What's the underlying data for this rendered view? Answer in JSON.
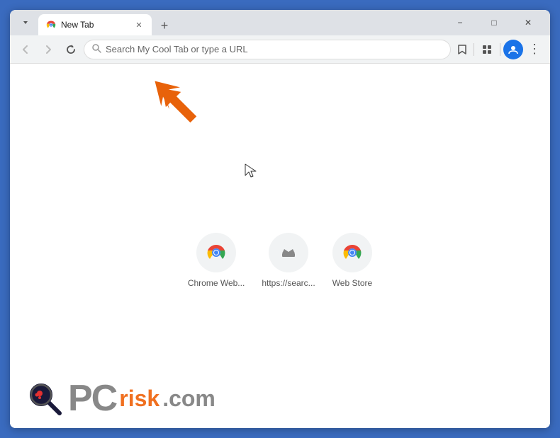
{
  "window": {
    "title": "New Tab",
    "outer_border_color": "#3a6bbf"
  },
  "titlebar": {
    "tab_label": "New Tab",
    "new_tab_icon": "+",
    "minimize_label": "−",
    "maximize_label": "□",
    "close_label": "✕"
  },
  "navbar": {
    "back_icon": "←",
    "forward_icon": "→",
    "refresh_icon": "↻",
    "search_placeholder": "Search My Cool Tab or type a URL",
    "bookmark_icon": "☆",
    "extensions_icon": "⧉",
    "profile_icon": "👤",
    "menu_icon": "⋮"
  },
  "shortcuts": [
    {
      "label": "Chrome Web...",
      "type": "chrome"
    },
    {
      "label": "https://searc...",
      "type": "search"
    },
    {
      "label": "Web Store",
      "type": "chrome"
    }
  ],
  "watermark": {
    "pc_text": "PC",
    "risk_text": "risk",
    "dot_com": ".com"
  }
}
